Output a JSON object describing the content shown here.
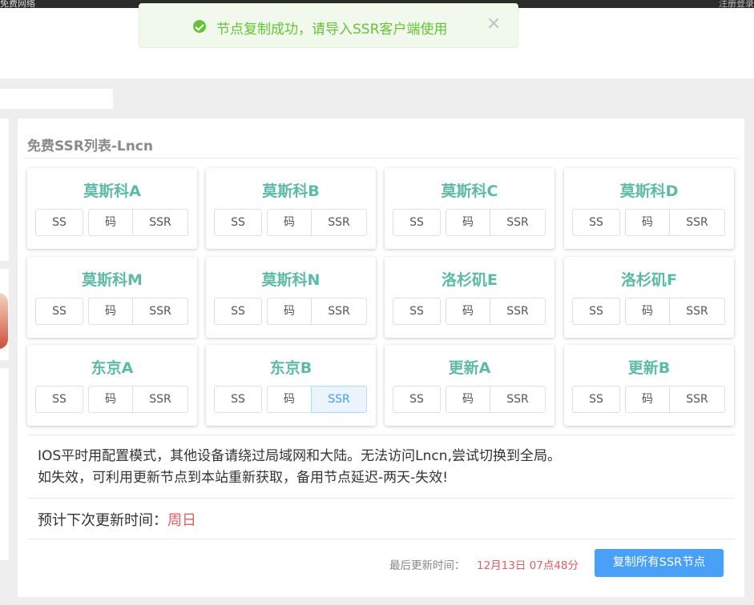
{
  "topbar": {
    "left_text": "免费网络",
    "right_text": "注册登录"
  },
  "toast": {
    "message": "节点复制成功，请导入SSR客户端使用",
    "close_glyph": "✕",
    "icon": "check-circle-icon",
    "color": "#67c23a"
  },
  "card": {
    "title": "免费SSR列表-Lncn",
    "nodes": [
      {
        "name": "莫斯科A",
        "ss": "SS",
        "code": "码",
        "ssr": "SSR"
      },
      {
        "name": "莫斯科B",
        "ss": "SS",
        "code": "码",
        "ssr": "SSR"
      },
      {
        "name": "莫斯科C",
        "ss": "SS",
        "code": "码",
        "ssr": "SSR"
      },
      {
        "name": "莫斯科D",
        "ss": "SS",
        "code": "码",
        "ssr": "SSR"
      },
      {
        "name": "莫斯科M",
        "ss": "SS",
        "code": "码",
        "ssr": "SSR"
      },
      {
        "name": "莫斯科N",
        "ss": "SS",
        "code": "码",
        "ssr": "SSR"
      },
      {
        "name": "洛杉矶E",
        "ss": "SS",
        "code": "码",
        "ssr": "SSR"
      },
      {
        "name": "洛杉矶F",
        "ss": "SS",
        "code": "码",
        "ssr": "SSR"
      },
      {
        "name": "东京A",
        "ss": "SS",
        "code": "码",
        "ssr": "SSR"
      },
      {
        "name": "东京B",
        "ss": "SS",
        "code": "码",
        "ssr": "SSR",
        "ssr_active": true
      },
      {
        "name": "更新A",
        "ss": "SS",
        "code": "码",
        "ssr": "SSR"
      },
      {
        "name": "更新B",
        "ss": "SS",
        "code": "码",
        "ssr": "SSR"
      }
    ],
    "info_line1": "IOS平时用配置模式，其他设备请绕过局域网和大陆。无法访问Lncn,尝试切换到全局。",
    "info_line2": "如失效，可利用更新节点到本站重新获取，备用节点延迟-两天-失效!",
    "schedule_label": "预计下次更新时间：",
    "schedule_day": "周日",
    "last_update_label": "最后更新时间：",
    "last_update_time": "12月13日 07点48分",
    "copy_all_label": "复制所有SSR节点"
  },
  "colors": {
    "node_name": "#5dbaa6",
    "accent_blue": "#49a0f6",
    "highlight_red": "#e06060"
  }
}
